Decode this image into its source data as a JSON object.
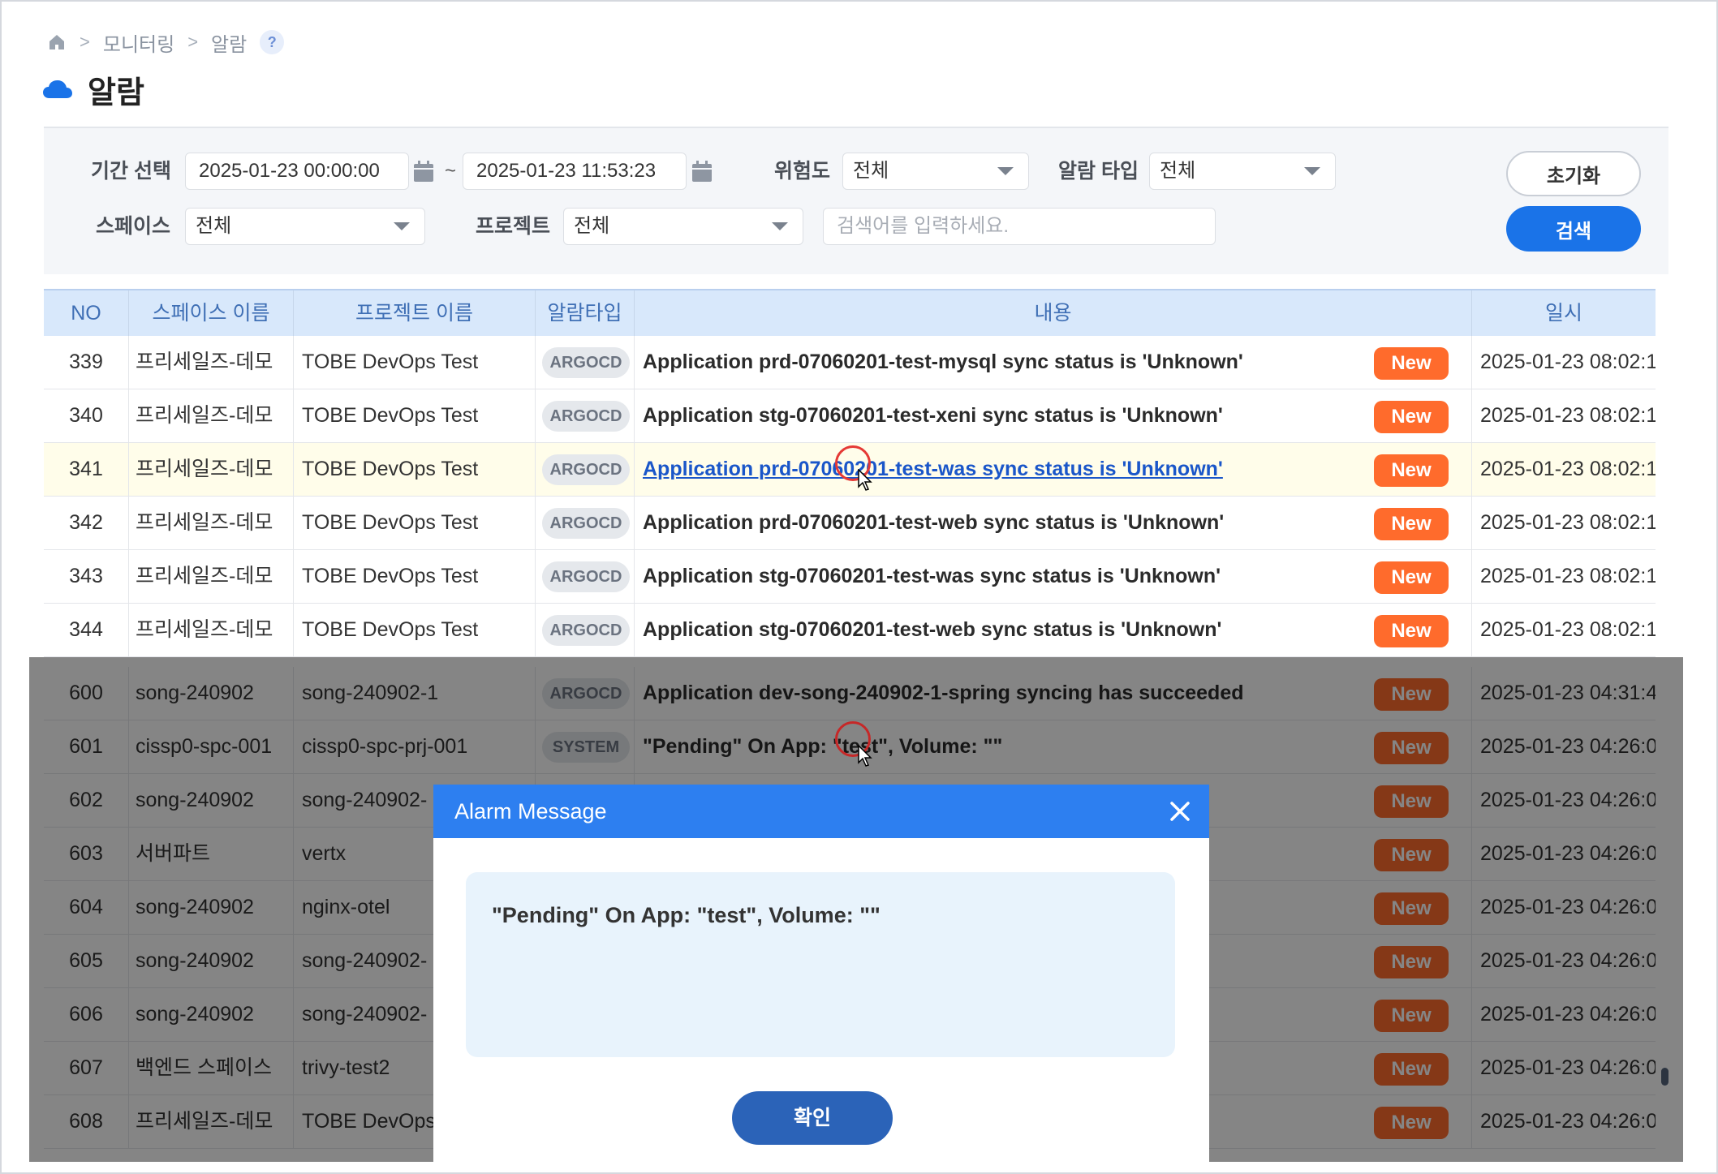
{
  "breadcrumb": {
    "items": [
      "모니터링",
      "알람"
    ],
    "sep": ">",
    "help": "?"
  },
  "page": {
    "title": "알람"
  },
  "filters": {
    "period_label": "기간 선택",
    "date_from": "2025-01-23 00:00:00",
    "date_to": "2025-01-23 11:53:23",
    "tilde": "~",
    "severity_label": "위험도",
    "severity_value": "전체",
    "alarm_type_label": "알람 타입",
    "alarm_type_value": "전체",
    "space_label": "스페이스",
    "space_value": "전체",
    "project_label": "프로젝트",
    "project_value": "전체",
    "search_placeholder": "검색어를 입력하세요.",
    "reset_label": "초기화",
    "search_label": "검색"
  },
  "table": {
    "headers": {
      "no": "NO",
      "space": "스페이스 이름",
      "project": "프로젝트 이름",
      "type": "알람타입",
      "content": "내용",
      "date": "일시"
    },
    "rows": [
      {
        "no": "339",
        "space": "프리세일즈-데모",
        "project": "TOBE DevOps Test",
        "type": "ARGOCD",
        "msg": "Application prd-07060201-test-mysql sync status is 'Unknown'",
        "badge": "New",
        "date": "2025-01-23 08:02:1"
      },
      {
        "no": "340",
        "space": "프리세일즈-데모",
        "project": "TOBE DevOps Test",
        "type": "ARGOCD",
        "msg": "Application stg-07060201-test-xeni sync status is 'Unknown'",
        "badge": "New",
        "date": "2025-01-23 08:02:1"
      },
      {
        "no": "341",
        "space": "프리세일즈-데모",
        "project": "TOBE DevOps Test",
        "type": "ARGOCD",
        "msg": "Application prd-07060201-test-was sync status is 'Unknown'",
        "badge": "New",
        "date": "2025-01-23 08:02:1"
      },
      {
        "no": "342",
        "space": "프리세일즈-데모",
        "project": "TOBE DevOps Test",
        "type": "ARGOCD",
        "msg": "Application prd-07060201-test-web sync status is 'Unknown'",
        "badge": "New",
        "date": "2025-01-23 08:02:1"
      },
      {
        "no": "343",
        "space": "프리세일즈-데모",
        "project": "TOBE DevOps Test",
        "type": "ARGOCD",
        "msg": "Application stg-07060201-test-was sync status is 'Unknown'",
        "badge": "New",
        "date": "2025-01-23 08:02:1"
      },
      {
        "no": "344",
        "space": "프리세일즈-데모",
        "project": "TOBE DevOps Test",
        "type": "ARGOCD",
        "msg": "Application stg-07060201-test-web sync status is 'Unknown'",
        "badge": "New",
        "date": "2025-01-23 08:02:1"
      },
      {
        "no": "600",
        "space": "song-240902",
        "project": "song-240902-1",
        "type": "ARGOCD",
        "msg": "Application dev-song-240902-1-spring  syncing has succeeded",
        "badge": "New",
        "date": "2025-01-23 04:31:4"
      },
      {
        "no": "601",
        "space": "cissp0-spc-001",
        "project": "cissp0-spc-prj-001",
        "type": "SYSTEM",
        "msg": "\"Pending\" On App: \"test\", Volume: \"\"",
        "badge": "New",
        "date": "2025-01-23 04:26:0"
      },
      {
        "no": "602",
        "space": "song-240902",
        "project": "song-240902-",
        "type": "",
        "msg": "",
        "badge": "New",
        "date": "2025-01-23 04:26:0"
      },
      {
        "no": "603",
        "space": "서버파트",
        "project": "vertx",
        "type": "",
        "msg": "",
        "badge": "New",
        "date": "2025-01-23 04:26:0"
      },
      {
        "no": "604",
        "space": "song-240902",
        "project": "nginx-otel",
        "type": "",
        "msg": "",
        "badge": "New",
        "date": "2025-01-23 04:26:0"
      },
      {
        "no": "605",
        "space": "song-240902",
        "project": "song-240902-",
        "type": "",
        "msg": "",
        "badge": "New",
        "date": "2025-01-23 04:26:0"
      },
      {
        "no": "606",
        "space": "song-240902",
        "project": "song-240902-",
        "type": "",
        "msg": "",
        "badge": "New",
        "date": "2025-01-23 04:26:0"
      },
      {
        "no": "607",
        "space": "백엔드 스페이스",
        "project": "trivy-test2",
        "type": "",
        "msg": "",
        "badge": "New",
        "date": "2025-01-23 04:26:0"
      },
      {
        "no": "608",
        "space": "프리세일즈-데모",
        "project": "TOBE DevOps T",
        "type": "",
        "msg": "",
        "badge": "New",
        "date": "2025-01-23 04:26:0"
      }
    ]
  },
  "modal": {
    "title": "Alarm Message",
    "message": "\"Pending\" On App: \"test\", Volume: \"\"",
    "ok_label": "확인"
  },
  "colors": {
    "primary": "#1a73e8",
    "modal_header": "#2d7ff0",
    "new_badge": "#ff6b2c",
    "link": "#1a56c9",
    "table_header_bg": "#d8e8fb"
  },
  "icons": {
    "home": "home-icon",
    "page": "cloud-icon",
    "calendar": "calendar-icon",
    "close": "close-icon",
    "dropdown": "caret-down-icon"
  }
}
